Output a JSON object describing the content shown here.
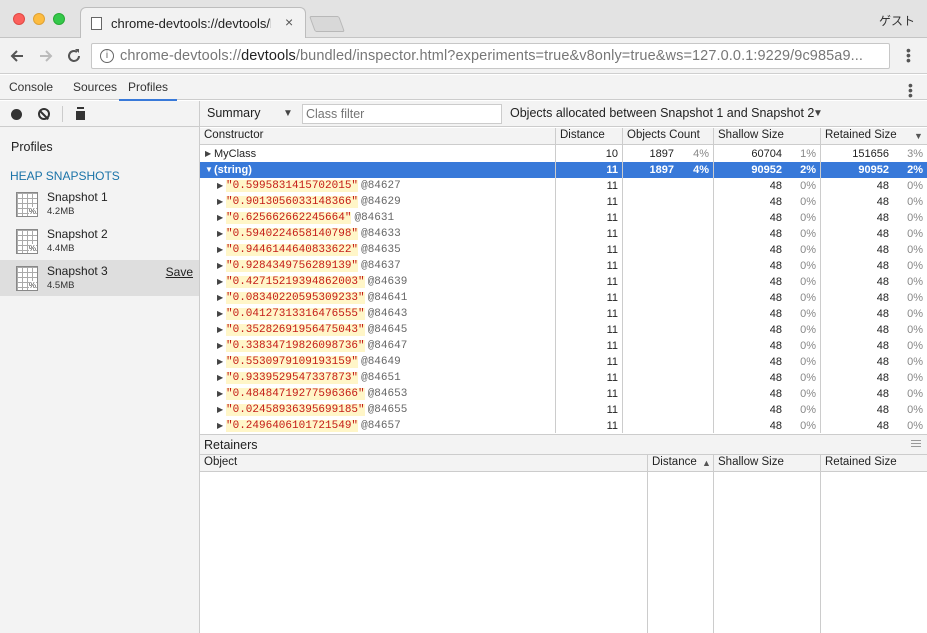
{
  "browser": {
    "tab_title": "chrome-devtools://devtools/bundled/inspector.html",
    "tab_close": "×",
    "profile_label": "ゲスト",
    "url_prefix": "chrome-devtools://",
    "url_host": "devtools",
    "url_rest": "/bundled/inspector.html?experiments=true&v8only=true&ws=127.0.0.1:9229/9c985a9...",
    "info": "i"
  },
  "devtools_tabs": [
    "Console",
    "Sources",
    "Profiles"
  ],
  "sidebar": {
    "profiles_label": "Profiles",
    "heap_label": "HEAP SNAPSHOTS",
    "snapshots": [
      {
        "name": "Snapshot 1",
        "size": "4.2MB"
      },
      {
        "name": "Snapshot 2",
        "size": "4.4MB"
      },
      {
        "name": "Snapshot 3",
        "size": "4.5MB",
        "save": "Save"
      }
    ],
    "icon_badge": "%"
  },
  "toolbar": {
    "view": "Summary",
    "class_filter_placeholder": "Class filter",
    "range": "Objects allocated between Snapshot 1 and Snapshot 2"
  },
  "columns": {
    "constructor": "Constructor",
    "distance": "Distance",
    "objects_count": "Objects Count",
    "shallow_size": "Shallow Size",
    "retained_size": "Retained Size"
  },
  "group_rows": [
    {
      "name": "MyClass",
      "distance": "10",
      "count": "1897",
      "count_pct": "4%",
      "shallow": "60704",
      "shallow_pct": "1%",
      "retained": "151656",
      "retained_pct": "3%"
    },
    {
      "name": "(string)",
      "distance": "11",
      "count": "1897",
      "count_pct": "4%",
      "shallow": "90952",
      "shallow_pct": "2%",
      "retained": "90952",
      "retained_pct": "2%"
    }
  ],
  "string_rows": [
    {
      "value": "\"0.5995831415702015\"",
      "id": "@84627"
    },
    {
      "value": "\"0.9013056033148366\"",
      "id": "@84629"
    },
    {
      "value": "\"0.625662662245664\"",
      "id": "@84631"
    },
    {
      "value": "\"0.5940224658140798\"",
      "id": "@84633"
    },
    {
      "value": "\"0.9446144640833622\"",
      "id": "@84635"
    },
    {
      "value": "\"0.9284349756289139\"",
      "id": "@84637"
    },
    {
      "value": "\"0.42715219394862003\"",
      "id": "@84639"
    },
    {
      "value": "\"0.08340220595309233\"",
      "id": "@84641"
    },
    {
      "value": "\"0.04127313316476555\"",
      "id": "@84643"
    },
    {
      "value": "\"0.35282691956475043\"",
      "id": "@84645"
    },
    {
      "value": "\"0.33834719826098736\"",
      "id": "@84647"
    },
    {
      "value": "\"0.5530979109193159\"",
      "id": "@84649"
    },
    {
      "value": "\"0.9339529547337873\"",
      "id": "@84651"
    },
    {
      "value": "\"0.48484719277596366\"",
      "id": "@84653"
    },
    {
      "value": "\"0.02458936395699185\"",
      "id": "@84655"
    },
    {
      "value": "\"0.2496406101721549\"",
      "id": "@84657"
    }
  ],
  "string_row_common": {
    "distance": "11",
    "shallow": "48",
    "shallow_pct": "0%",
    "retained": "48",
    "retained_pct": "0%"
  },
  "retainers": {
    "title": "Retainers",
    "columns": {
      "object": "Object",
      "distance": "Distance",
      "shallow_size": "Shallow Size",
      "retained_size": "Retained Size"
    }
  },
  "colors": {
    "selection": "#3879d9",
    "string_value": "#c41a16"
  }
}
